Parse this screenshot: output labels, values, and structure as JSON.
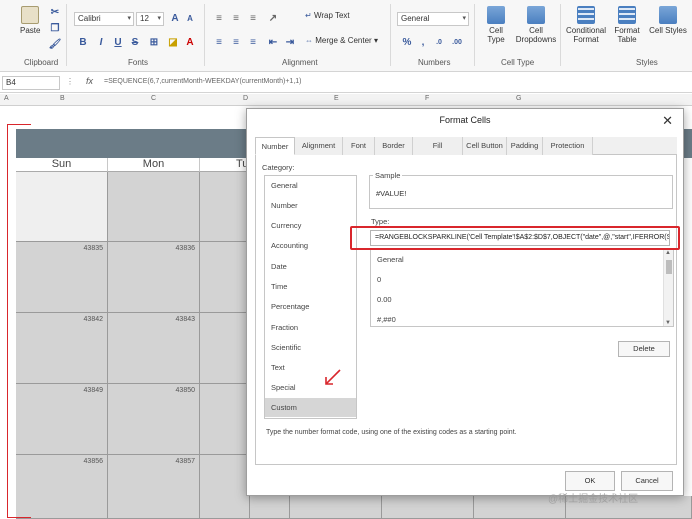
{
  "ribbon": {
    "paste": "Paste",
    "clipboard": "Clipboard",
    "font_name": "Calibri",
    "font_size": "12",
    "fonts": "Fonts",
    "bold": "B",
    "italic": "I",
    "underline": "U",
    "strike": "S",
    "grow": "A",
    "shrink": "A",
    "wrap_text": "Wrap Text",
    "merge_center": "Merge & Center",
    "alignment": "Alignment",
    "number_format": "General",
    "numbers": "Numbers",
    "percent": "%",
    "comma": ",",
    "cell_type": "Cell Type",
    "cell_dropdowns": "Cell Dropdowns",
    "cell_type_group": "Cell Type",
    "conditional_format": "Conditional Format",
    "format_table": "Format Table",
    "cell_styles": "Cell Styles",
    "styles": "Styles"
  },
  "formula_bar": {
    "cell_ref": "B4",
    "fx": "fx",
    "formula": "=SEQUENCE(6,7,currentMonth-WEEKDAY(currentMonth)+1,1)"
  },
  "columns": [
    "A",
    "B",
    "C",
    "D",
    "E",
    "F",
    "G"
  ],
  "calendar": {
    "days": [
      "Sun",
      "Mon",
      "Tu"
    ],
    "rows": [
      [
        "",
        ""
      ],
      [
        "43835",
        "43836"
      ],
      [
        "43842",
        "43843"
      ],
      [
        "43849",
        "43850"
      ],
      [
        "43856",
        "43857"
      ]
    ]
  },
  "dialog": {
    "title": "Format Cells",
    "tabs": [
      "Number",
      "Alignment",
      "Font",
      "Border",
      "Fill",
      "Cell Button",
      "Padding",
      "Protection"
    ],
    "category_label": "Category:",
    "categories": [
      "General",
      "Number",
      "Currency",
      "Accounting",
      "Date",
      "Time",
      "Percentage",
      "Fraction",
      "Scientific",
      "Text",
      "Special",
      "Custom"
    ],
    "selected_category": "Custom",
    "sample_label": "Sample",
    "sample_value": "#VALUE!",
    "type_label": "Type:",
    "type_value": "=RANGEBLOCKSPARKLINE('Cell Template'!$A$2:$D$7,OBJECT(\"date\",@,\"start\",IFERROR(SUI",
    "codes": [
      "General",
      "0",
      "0.00",
      "#,##0"
    ],
    "delete": "Delete",
    "hint": "Type the number format code, using one of the existing codes as a starting point.",
    "ok": "OK",
    "cancel": "Cancel"
  },
  "watermark": "@稀土掘金技术社区",
  "colors": {
    "accent_red": "#d9262c",
    "title_band": "#6b7c87",
    "cell_gray": "#d3d3d3"
  }
}
